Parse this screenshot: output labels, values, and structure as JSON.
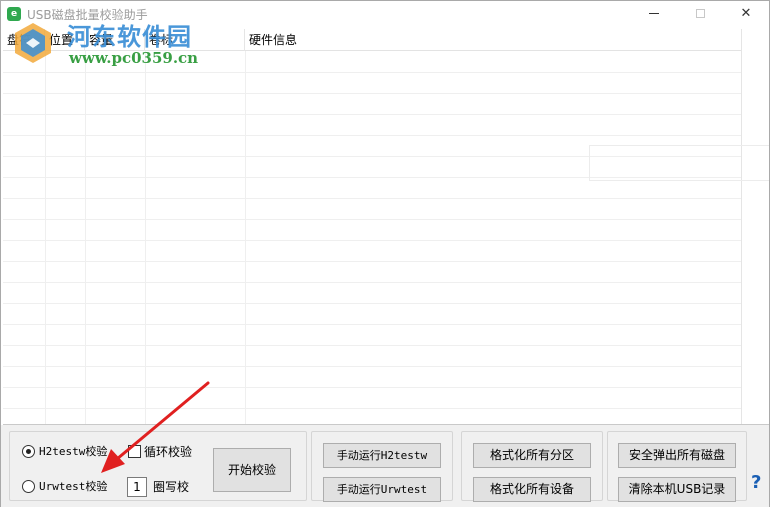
{
  "window": {
    "app_icon": "e",
    "title": "USB磁盘批量校验助手",
    "minimize_icon": "minimize-icon",
    "maximize_icon": "maximize-icon",
    "close_icon": "✕"
  },
  "watermark": {
    "site_name": "河东软件园",
    "url": "www.pc0359.cn"
  },
  "list": {
    "columns": [
      "盘符",
      "位置",
      "容量",
      "卷标",
      "硬件信息"
    ]
  },
  "mode": {
    "h2testw_label": "H2testw校验",
    "urwtest_label": "Urwtest校验",
    "selected": "H2testw校验",
    "loop_label": "循环校验",
    "loop_checked": false,
    "rounds_value": "1",
    "rounds_label": "圈写校",
    "start_button": "开始校验"
  },
  "manual": {
    "run_h2testw": "手动运行H2testw",
    "run_urwtest": "手动运行Urwtest"
  },
  "format": {
    "all_partitions": "格式化所有分区",
    "all_devices": "格式化所有设备"
  },
  "eject": {
    "eject_all": "安全弹出所有磁盘",
    "clear_usb": "清除本机USB记录"
  },
  "help": {
    "label": "?"
  },
  "colors": {
    "watermark_text": "#3b8fd6",
    "watermark_url": "#2f9a3a",
    "arrow": "#e02020",
    "panel_bg": "#f0f0f0"
  }
}
